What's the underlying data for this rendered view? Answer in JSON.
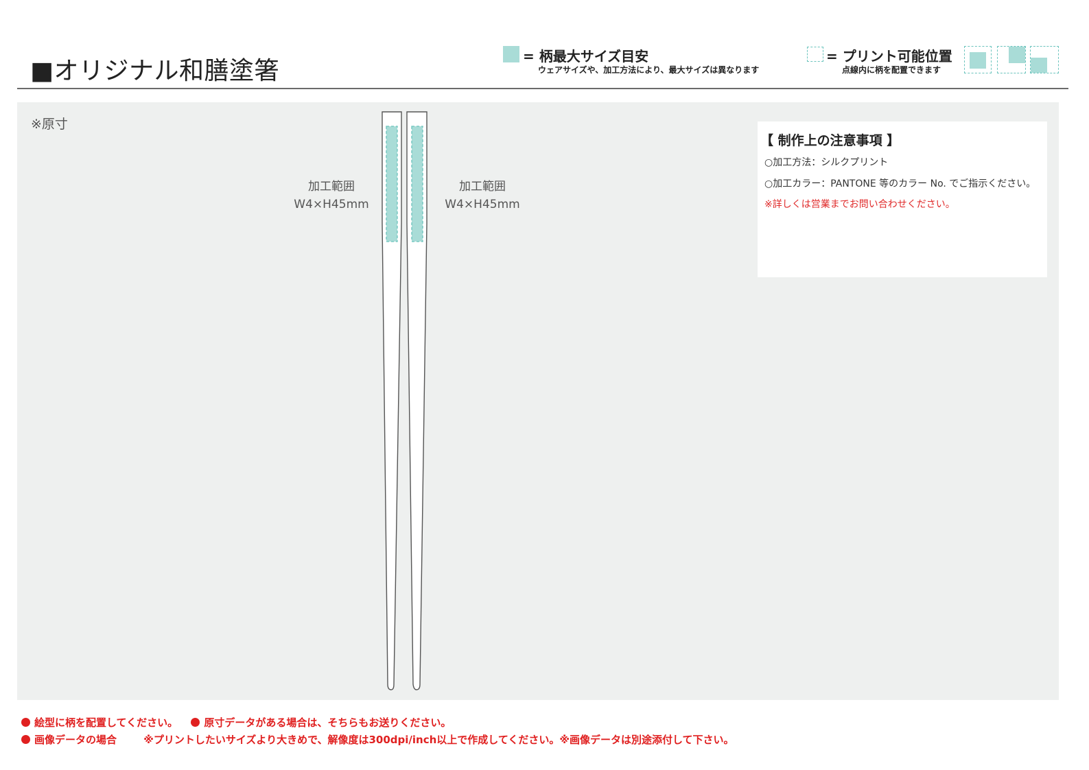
{
  "title": "■オリジナル和膳塗箸",
  "legend": {
    "max_size_head": "= 柄最大サイズ目安",
    "max_size_sub": "ウェアサイズや、加工方法により、最大サイズは異なります",
    "print_pos_head": "= プリント可能位置",
    "print_pos_sub": "点線内に柄を配置できます",
    "colors": {
      "fill": "#a9dcd7",
      "dashed": "#6bc4bd"
    }
  },
  "scale_note": "※原寸",
  "print_area": {
    "left": {
      "label": "加工範囲",
      "size": "W4×H45mm"
    },
    "right": {
      "label": "加工範囲",
      "size": "W4×H45mm"
    }
  },
  "notes": {
    "heading": "【 制作上の注意事項 】",
    "method": "○加工方法：シルクプリント",
    "color": "○加工カラー：PANTONE 等のカラー No. でご指示ください。",
    "contact": "※詳しくは営業までお問い合わせください。"
  },
  "footer": {
    "line1_a": "絵型に柄を配置してください。",
    "line1_b": "原寸データがある場合は、そちらもお送りください。",
    "line2_a": "画像データの場合",
    "line2_b": "※プリントしたいサイズより大きめで、解像度は300dpi/inch以上で作成してください。※画像データは別途添付して下さい。"
  },
  "accent_red": "#e02020",
  "background_gray": "#eef0ef"
}
